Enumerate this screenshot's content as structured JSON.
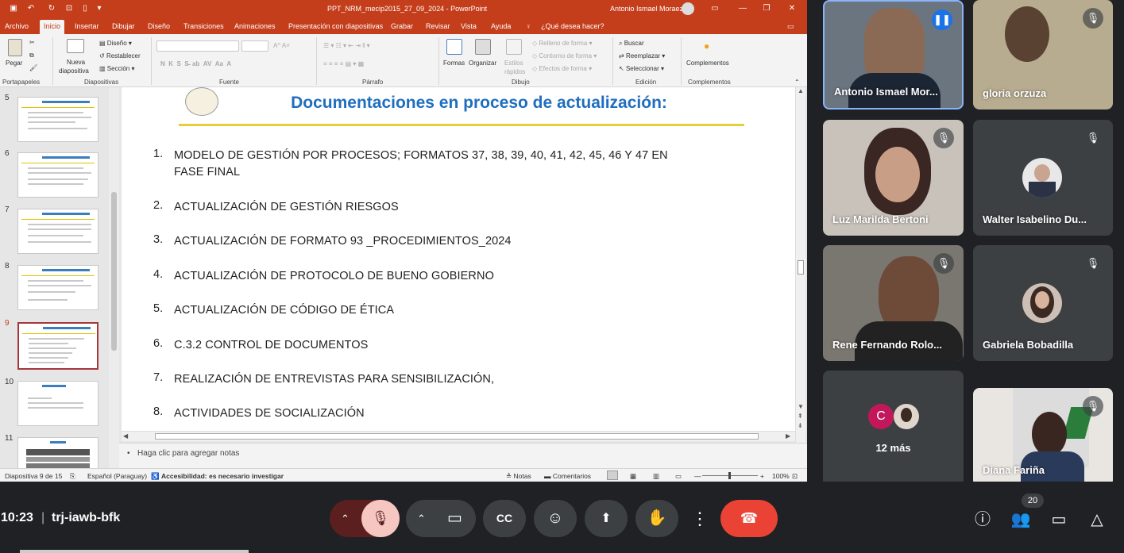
{
  "ppt": {
    "title": "PPT_NRM_mecip2015_27_09_2024 - PowerPoint",
    "user": "Antonio Ismael Moraez",
    "menu": [
      "Archivo",
      "Inicio",
      "Insertar",
      "Dibujar",
      "Diseño",
      "Transiciones",
      "Animaciones",
      "Presentación con diapositivas",
      "Grabar",
      "Revisar",
      "Vista",
      "Ayuda",
      "¿Qué desea hacer?"
    ],
    "ribbon": {
      "pegar": "Pegar",
      "nueva": "Nueva",
      "diapositiva": "diapositiva",
      "diseno": "Diseño",
      "restablecer": "Restablecer",
      "seccion": "Sección",
      "formas": "Formas",
      "organizar": "Organizar",
      "estilos": "Estilos",
      "rapidos": "rápidos",
      "relleno": "Relleno de forma",
      "contorno": "Contorno de forma",
      "efectos": "Efectos de forma",
      "buscar": "Buscar",
      "reemplazar": "Reemplazar",
      "seleccionar": "Seleccionar",
      "complementos": "Complementos",
      "groups": [
        "Portapapeles",
        "Diapositivas",
        "Fuente",
        "Párrafo",
        "Dibujo",
        "Edición",
        "Complementos"
      ]
    },
    "thumbs": [
      "5",
      "6",
      "7",
      "8",
      "9",
      "10",
      "11"
    ],
    "slide": {
      "title": "Documentaciones en proceso de actualización:",
      "items": [
        {
          "n": "1.",
          "text": "MODELO DE GESTIÓN POR PROCESOS; FORMATOS 37, 38, 39, 40, 41, 42, 45, 46 Y 47 EN FASE FINAL"
        },
        {
          "n": "2.",
          "text": "ACTUALIZACIÓN DE GESTIÓN RIESGOS"
        },
        {
          "n": "3.",
          "text": "ACTUALIZACIÓN DE FORMATO 93 _PROCEDIMIENTOS_2024"
        },
        {
          "n": "4.",
          "text": "ACTUALIZACIÓN DE PROTOCOLO DE BUENO GOBIERNO"
        },
        {
          "n": "5.",
          "text": "ACTUALIZACIÓN DE CÓDIGO DE ÉTICA"
        },
        {
          "n": "6.",
          "text": "C.3.2 CONTROL DE DOCUMENTOS"
        },
        {
          "n": "7.",
          "text": "REALIZACIÓN DE ENTREVISTAS PARA SENSIBILIZACIÓN,"
        },
        {
          "n": "8.",
          "text": "ACTIVIDADES DE SOCIALIZACIÓN"
        }
      ]
    },
    "notes_placeholder": "Haga clic para agregar notas",
    "status": {
      "slide": "Diapositiva 9 de 15",
      "lang": "Español (Paraguay)",
      "access": "Accesibilidad: es necesario investigar",
      "notes": "Notas",
      "comments": "Comentarios",
      "zoom": "100%"
    }
  },
  "meet": {
    "participants": [
      {
        "name": "Antonio Ismael Mor...",
        "speaking": true
      },
      {
        "name": "gloria orzuza",
        "muted": true
      },
      {
        "name": "Luz Marilda Bertoni",
        "muted": true
      },
      {
        "name": "Walter Isabelino Du...",
        "muted": true
      },
      {
        "name": "Rene Fernando Rolo...",
        "muted": true
      },
      {
        "name": "Gabriela Bobadilla",
        "muted": true
      },
      {
        "name": "Diana Fariña",
        "muted": true
      }
    ],
    "more": {
      "initial": "C",
      "label": "12 más"
    },
    "time": "10:23",
    "code": "trj-iawb-bfk",
    "people_count": "20"
  },
  "colors": {
    "ppt_accent": "#c43e1c",
    "slide_title": "#1f6ebf",
    "end_call": "#ea4335",
    "bg": "#202124"
  }
}
